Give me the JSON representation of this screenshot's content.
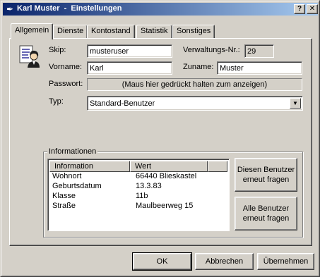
{
  "window": {
    "title": "Karl Muster  -  Einstellungen",
    "help_glyph": "?",
    "close_glyph": "✕",
    "app_icon": "quill-pen-icon"
  },
  "tabs": [
    {
      "label": "Allgemein",
      "active": true
    },
    {
      "label": "Dienste",
      "active": false
    },
    {
      "label": "Kontostand",
      "active": false
    },
    {
      "label": "Statistik",
      "active": false
    },
    {
      "label": "Sonstiges",
      "active": false
    }
  ],
  "form": {
    "skip_label": "Skip:",
    "skip_value": "musteruser",
    "verwaltung_label": "Verwaltungs-Nr.:",
    "verwaltung_value": "29",
    "vorname_label": "Vorname:",
    "vorname_value": "Karl",
    "zuname_label": "Zuname:",
    "zuname_value": "Muster",
    "passwort_label": "Passwort:",
    "passwort_hint": "(Maus hier gedrückt halten zum anzeigen)",
    "typ_label": "Typ:",
    "typ_value": "Standard-Benutzer"
  },
  "info": {
    "group_title": "Informationen",
    "columns": [
      "Information",
      "Wert"
    ],
    "rows": [
      {
        "key": "Wohnort",
        "value": "66440 Blieskastel"
      },
      {
        "key": "Geburtsdatum",
        "value": "13.3.83"
      },
      {
        "key": "Klasse",
        "value": "11b"
      },
      {
        "key": "Straße",
        "value": "Maulbeerweg 15"
      }
    ],
    "btn_ask_user": "Diesen Benutzer erneut fragen",
    "btn_ask_all": "Alle Benutzer erneut fragen"
  },
  "footer": {
    "ok": "OK",
    "cancel": "Abbrechen",
    "apply": "Übernehmen"
  }
}
